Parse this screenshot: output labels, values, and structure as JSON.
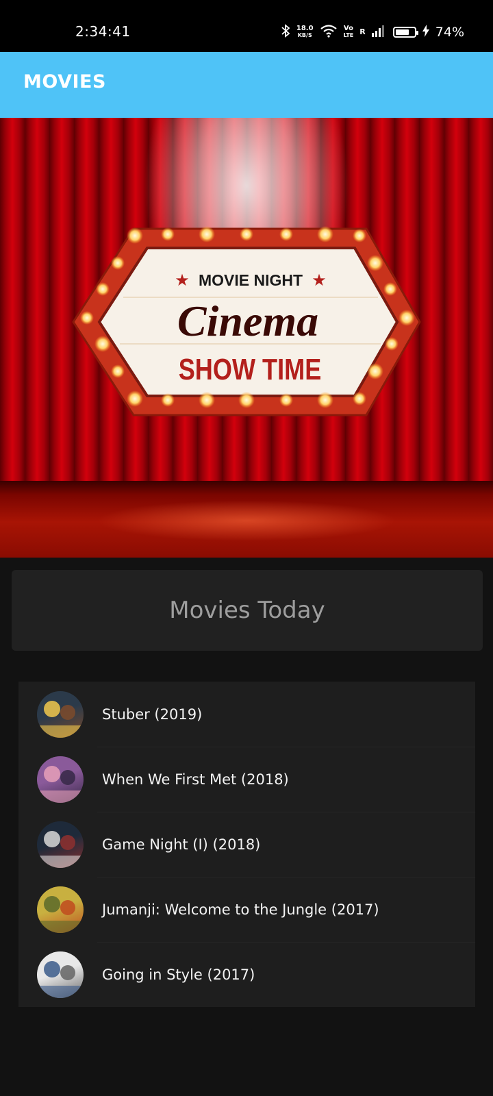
{
  "status_bar": {
    "time": "2:34:41",
    "net_speed_top": "18.0",
    "net_speed_bottom": "KB/S",
    "volte_top": "Vo",
    "volte_bottom": "LTE",
    "roaming": "R",
    "battery_percent": "74%",
    "battery_level": 0.74
  },
  "app_bar": {
    "title": "MOVIES"
  },
  "hero": {
    "top_line": "MOVIE NIGHT",
    "main_word": "Cinema",
    "bottom_line": "SHOW TIME"
  },
  "section": {
    "title": "Movies Today"
  },
  "movies": [
    {
      "title": "Stuber (2019)",
      "poster_colors": [
        "#2b3a4a",
        "#f2c94c",
        "#7a4a2c"
      ]
    },
    {
      "title": "When We First Met (2018)",
      "poster_colors": [
        "#8a5a9a",
        "#e6a0b8",
        "#3a2a4a"
      ]
    },
    {
      "title": "Game Night (I) (2018)",
      "poster_colors": [
        "#1e2a3a",
        "#d8d8d8",
        "#8a3030"
      ]
    },
    {
      "title": "Jumanji: Welcome to the Jungle (2017)",
      "poster_colors": [
        "#c8b040",
        "#5a6a2a",
        "#c05020"
      ]
    },
    {
      "title": "Going in Style (2017)",
      "poster_colors": [
        "#e8e8e8",
        "#3a5a8a",
        "#6a6a6a"
      ]
    }
  ]
}
